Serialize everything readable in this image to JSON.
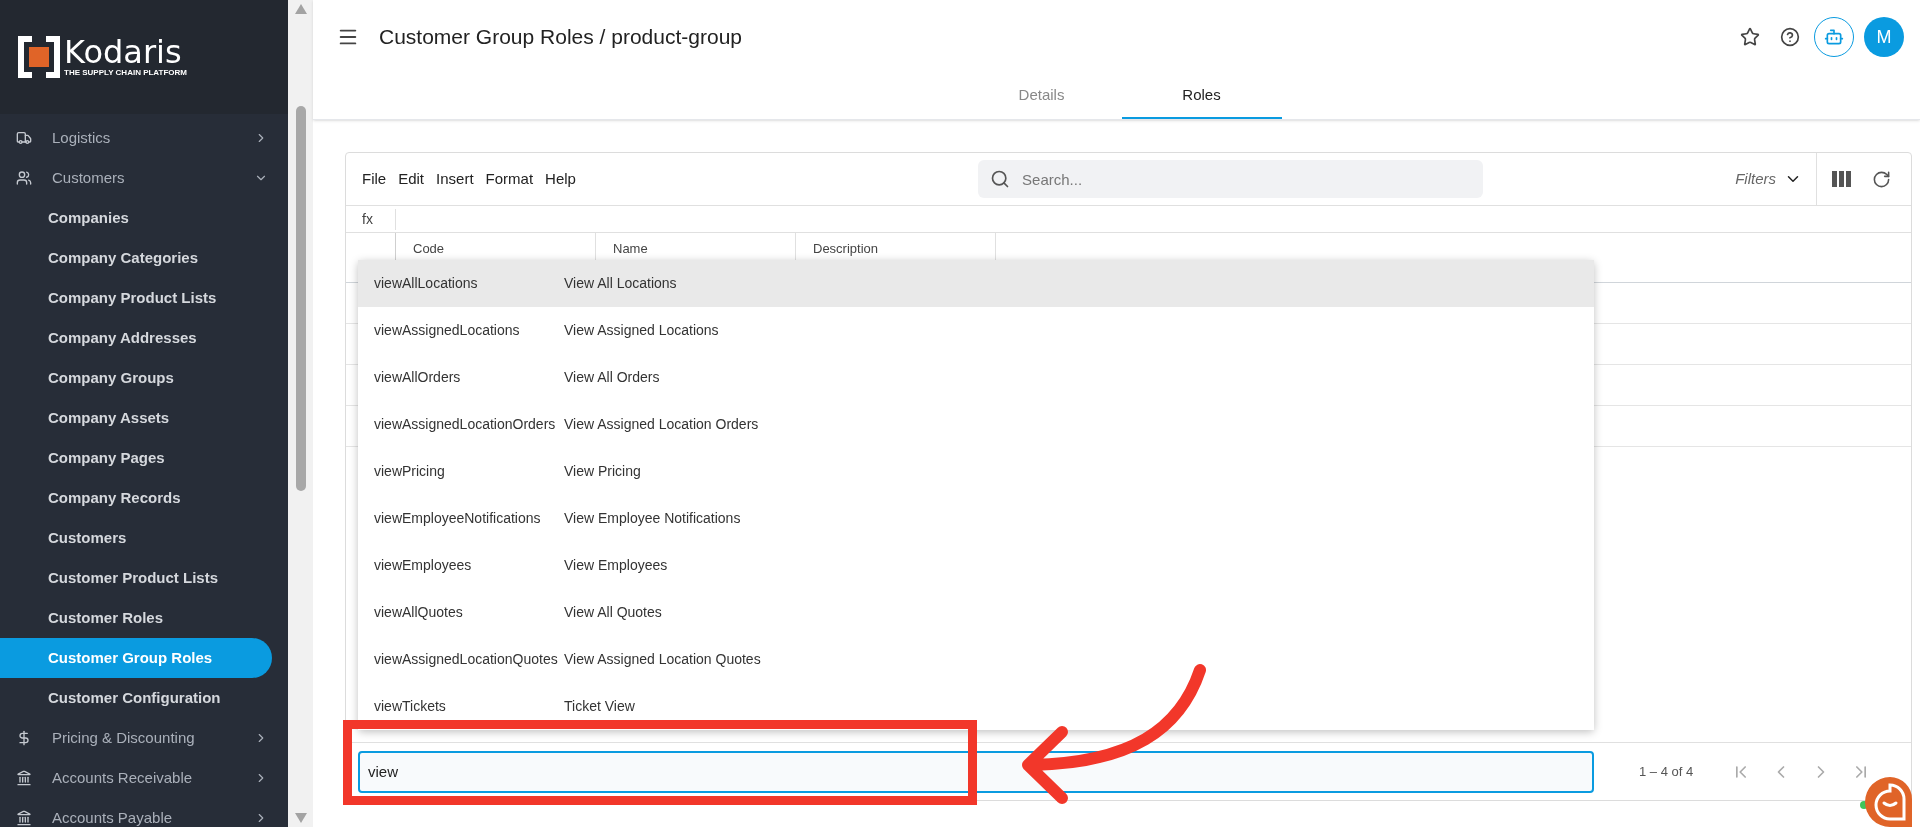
{
  "sidebar": {
    "logo": {
      "name": "Kodaris",
      "tagline": "THE SUPPLY CHAIN PLATFORM"
    },
    "items": [
      {
        "label": "Logistics",
        "kind": "logistics",
        "expanded": false
      },
      {
        "label": "Customers",
        "kind": "customers",
        "expanded": true,
        "children": [
          {
            "label": "Companies",
            "selected": false
          },
          {
            "label": "Company Categories",
            "selected": false
          },
          {
            "label": "Company Product Lists",
            "selected": false
          },
          {
            "label": "Company Addresses",
            "selected": false
          },
          {
            "label": "Company Groups",
            "selected": false
          },
          {
            "label": "Company Assets",
            "selected": false
          },
          {
            "label": "Company Pages",
            "selected": false
          },
          {
            "label": "Company Records",
            "selected": false
          },
          {
            "label": "Customers",
            "selected": false
          },
          {
            "label": "Customer Product Lists",
            "selected": false
          },
          {
            "label": "Customer Roles",
            "selected": false
          },
          {
            "label": "Customer Group Roles",
            "selected": true
          },
          {
            "label": "Customer Configuration",
            "selected": false
          }
        ]
      },
      {
        "label": "Pricing & Discounting",
        "kind": "pricing",
        "expanded": false
      },
      {
        "label": "Accounts Receivable",
        "kind": "bank",
        "expanded": false
      },
      {
        "label": "Accounts Payable",
        "kind": "bank",
        "expanded": false
      }
    ]
  },
  "header": {
    "title": "Customer Group Roles / product-group",
    "avatar": "M",
    "tabs": [
      {
        "label": "Details",
        "selected": false
      },
      {
        "label": "Roles",
        "selected": true
      }
    ]
  },
  "grid": {
    "menu": [
      "File",
      "Edit",
      "Insert",
      "Format",
      "Help"
    ],
    "search": {
      "placeholder": "Search..."
    },
    "filters": "Filters",
    "formula_label": "fx",
    "columns": [
      "Code",
      "Name",
      "Description"
    ],
    "suggestions": [
      {
        "code": "viewAllLocations",
        "name": "View All Locations",
        "selected": true
      },
      {
        "code": "viewAssignedLocations",
        "name": "View Assigned Locations",
        "selected": false
      },
      {
        "code": "viewAllOrders",
        "name": "View All Orders",
        "selected": false
      },
      {
        "code": "viewAssignedLocationOrders",
        "name": "View Assigned Location Orders",
        "selected": false
      },
      {
        "code": "viewPricing",
        "name": "View Pricing",
        "selected": false
      },
      {
        "code": "viewEmployeeNotifications",
        "name": "View Employee Notifications",
        "selected": false
      },
      {
        "code": "viewEmployees",
        "name": "View Employees",
        "selected": false
      },
      {
        "code": "viewAllQuotes",
        "name": "View All Quotes",
        "selected": false
      },
      {
        "code": "viewAssignedLocationQuotes",
        "name": "View Assigned Location Quotes",
        "selected": false
      },
      {
        "code": "viewTickets",
        "name": "Ticket View",
        "selected": false
      }
    ],
    "editor": {
      "value": "view"
    },
    "pagination": "1 – 4 of 4"
  }
}
